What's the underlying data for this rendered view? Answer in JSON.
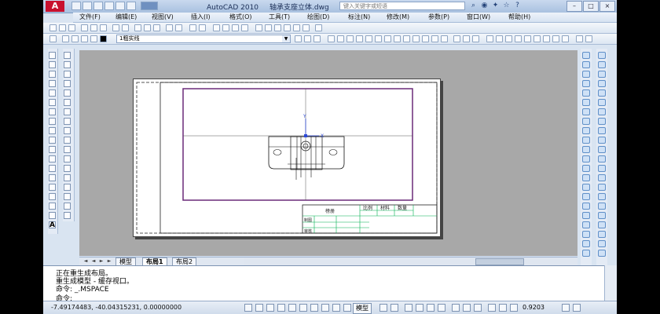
{
  "app": {
    "name": "AutoCAD 2010",
    "document": "轴承支座立体.dwg",
    "search_placeholder": "键入关键字或短语",
    "window_buttons": [
      "–",
      "□",
      "×"
    ]
  },
  "menu": [
    "文件(F)",
    "编辑(E)",
    "视图(V)",
    "插入(I)",
    "格式(O)",
    "工具(T)",
    "绘图(D)",
    "标注(N)",
    "修改(M)",
    "参数(P)",
    "窗口(W)",
    "帮助(H)"
  ],
  "layer": {
    "current": "1粗实线"
  },
  "layout_tabs": {
    "model": "模型",
    "layout1": "布局1",
    "layout2": "布局2"
  },
  "command_history": [
    "正在重生成布局。",
    "重生成模型 - 缓存视口。",
    "命令: _.MSPACE"
  ],
  "command_prompt": "命令:",
  "status": {
    "coords": "-7.49174483,  -40.04315231, 0.00000000",
    "model_label": "模型",
    "zoom": "0.9203"
  },
  "drawing": {
    "title_block": {
      "name_cell": "榜册",
      "col1": "比例",
      "col2": "材料",
      "col3": "数量",
      "row1": "制图",
      "row2": "审核"
    },
    "ucs": {
      "y": "Y",
      "x": "X"
    }
  },
  "colors": {
    "border": "#6a2a78",
    "title_block_lines": "#00b050",
    "canvas_bg": "#a8a8a8",
    "ui_bg": "#d9e4f1"
  }
}
